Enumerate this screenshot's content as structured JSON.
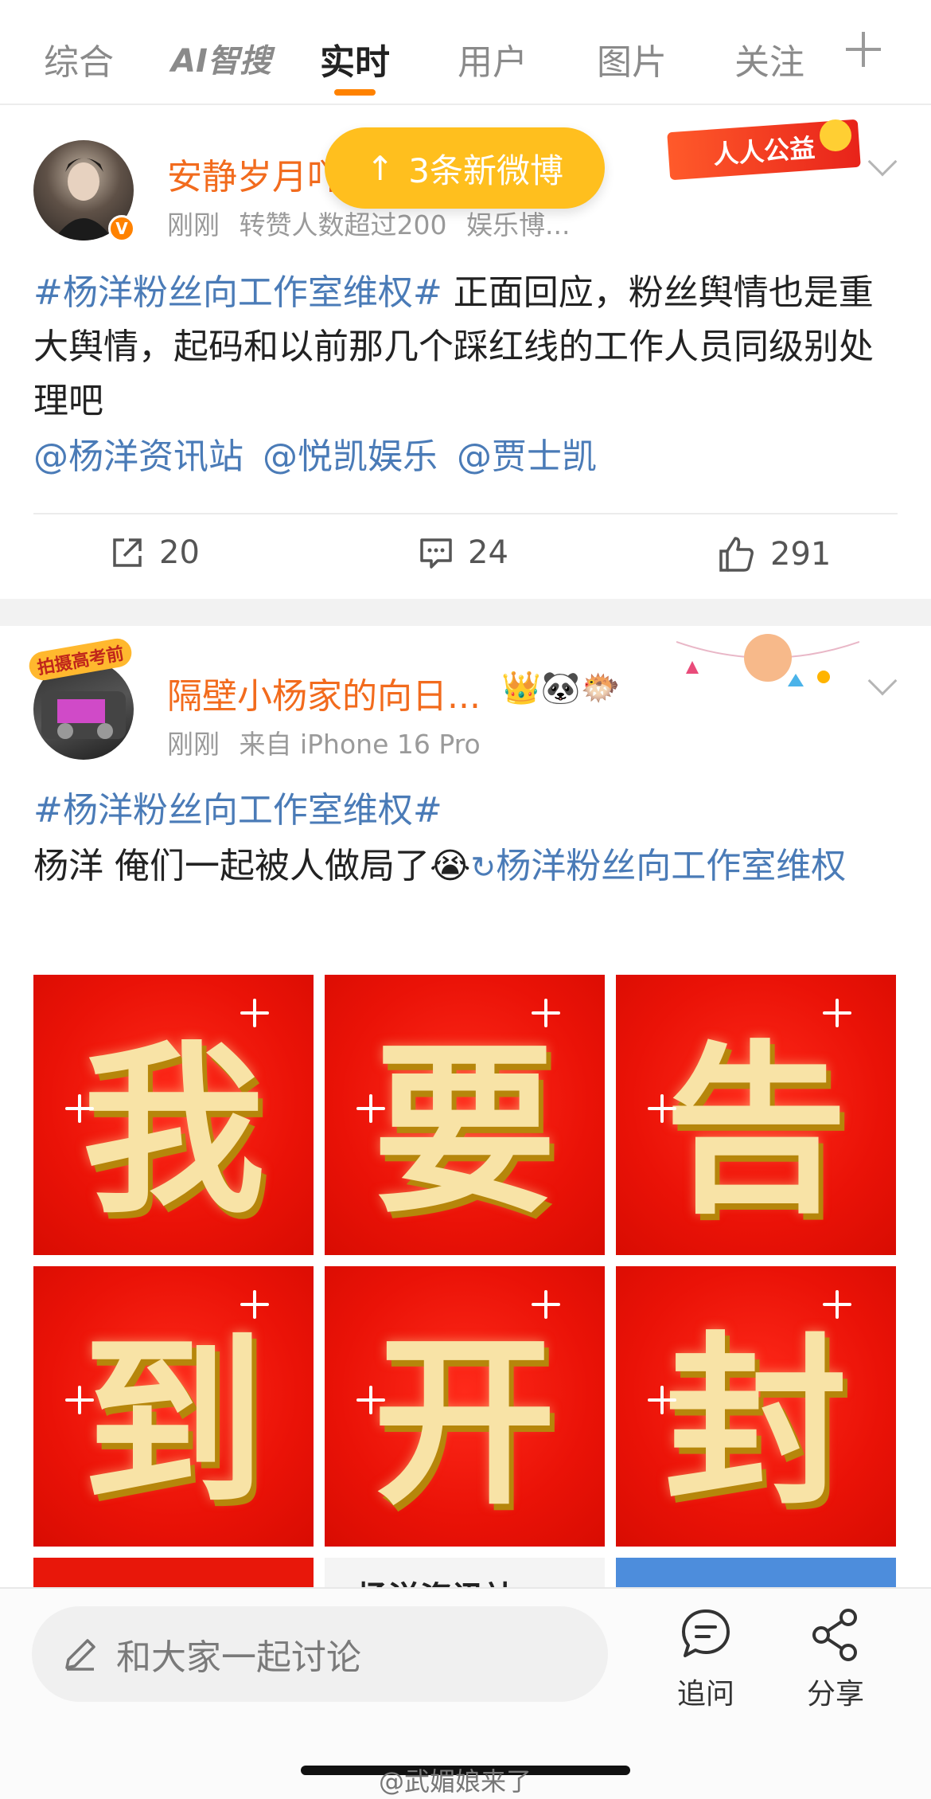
{
  "tabs": [
    "综合",
    "AI智搜",
    "实时",
    "用户",
    "图片",
    "关注"
  ],
  "new_posts_pill": "3条新微博",
  "post1": {
    "username": "安静岁月吖",
    "time": "刚刚",
    "meta": "转赞人数超过200",
    "source": "娱乐博...",
    "badge": "人人公益",
    "topic": "#杨洋粉丝向工作室维权#",
    "text": " 正面回应，粉丝舆情也是重大舆情，起码和以前那几个踩红线的工作人员同级别处理吧",
    "mentions": [
      "@杨洋资讯站",
      "@悦凯娱乐",
      "@贾士凯"
    ],
    "reposts": "20",
    "comments": "24",
    "likes": "291"
  },
  "post2": {
    "username": "隔壁小杨家的向日...",
    "avatar_label": "拍摄高考前",
    "time": "刚刚",
    "source": "来自 iPhone 16 Pro",
    "topic": "#杨洋粉丝向工作室维权#",
    "text": "杨洋 俺们一起被人做局了",
    "linked_topic": "杨洋粉丝向工作室维权",
    "grid_chars": [
      "我",
      "要",
      "告",
      "到",
      "开",
      "封"
    ],
    "partial_tile_text": "杨洋资讯站"
  },
  "bottom": {
    "comment_placeholder": "和大家一起讨论",
    "ask_label": "追问",
    "share_label": "分享"
  },
  "watermark": "@武媚娘来了",
  "colors": {
    "accent": "#ff8200",
    "link": "#4a7bb7",
    "username": "#f26b1d",
    "pill": "#ffbf1e"
  }
}
